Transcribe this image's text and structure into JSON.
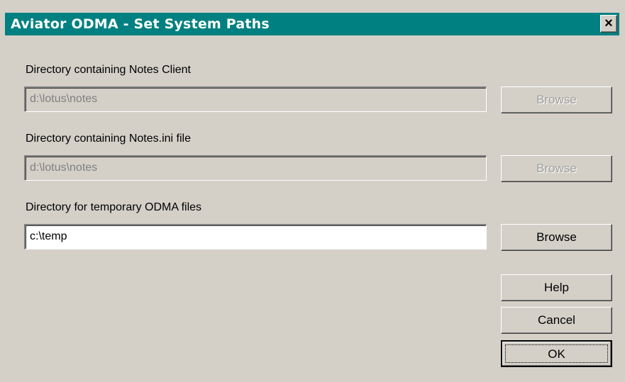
{
  "window": {
    "title": "Aviator ODMA - Set System Paths",
    "close_glyph": "×"
  },
  "notes_client": {
    "label": "Directory containing Notes Client",
    "value": "d:\\lotus\\notes",
    "enabled": false,
    "browse_label": "Browse"
  },
  "notes_ini": {
    "label": "Directory containing Notes.ini file",
    "value": "d:\\lotus\\notes",
    "enabled": false,
    "browse_label": "Browse"
  },
  "temp_dir": {
    "label": "Directory for temporary ODMA files",
    "value": "c:\\temp",
    "enabled": true,
    "browse_label": "Browse"
  },
  "actions": {
    "help_label": "Help",
    "cancel_label": "Cancel",
    "ok_label": "OK"
  },
  "colors": {
    "titlebar": "#008080",
    "dialog_face": "#d4d0c8",
    "disabled_text": "#808080"
  }
}
